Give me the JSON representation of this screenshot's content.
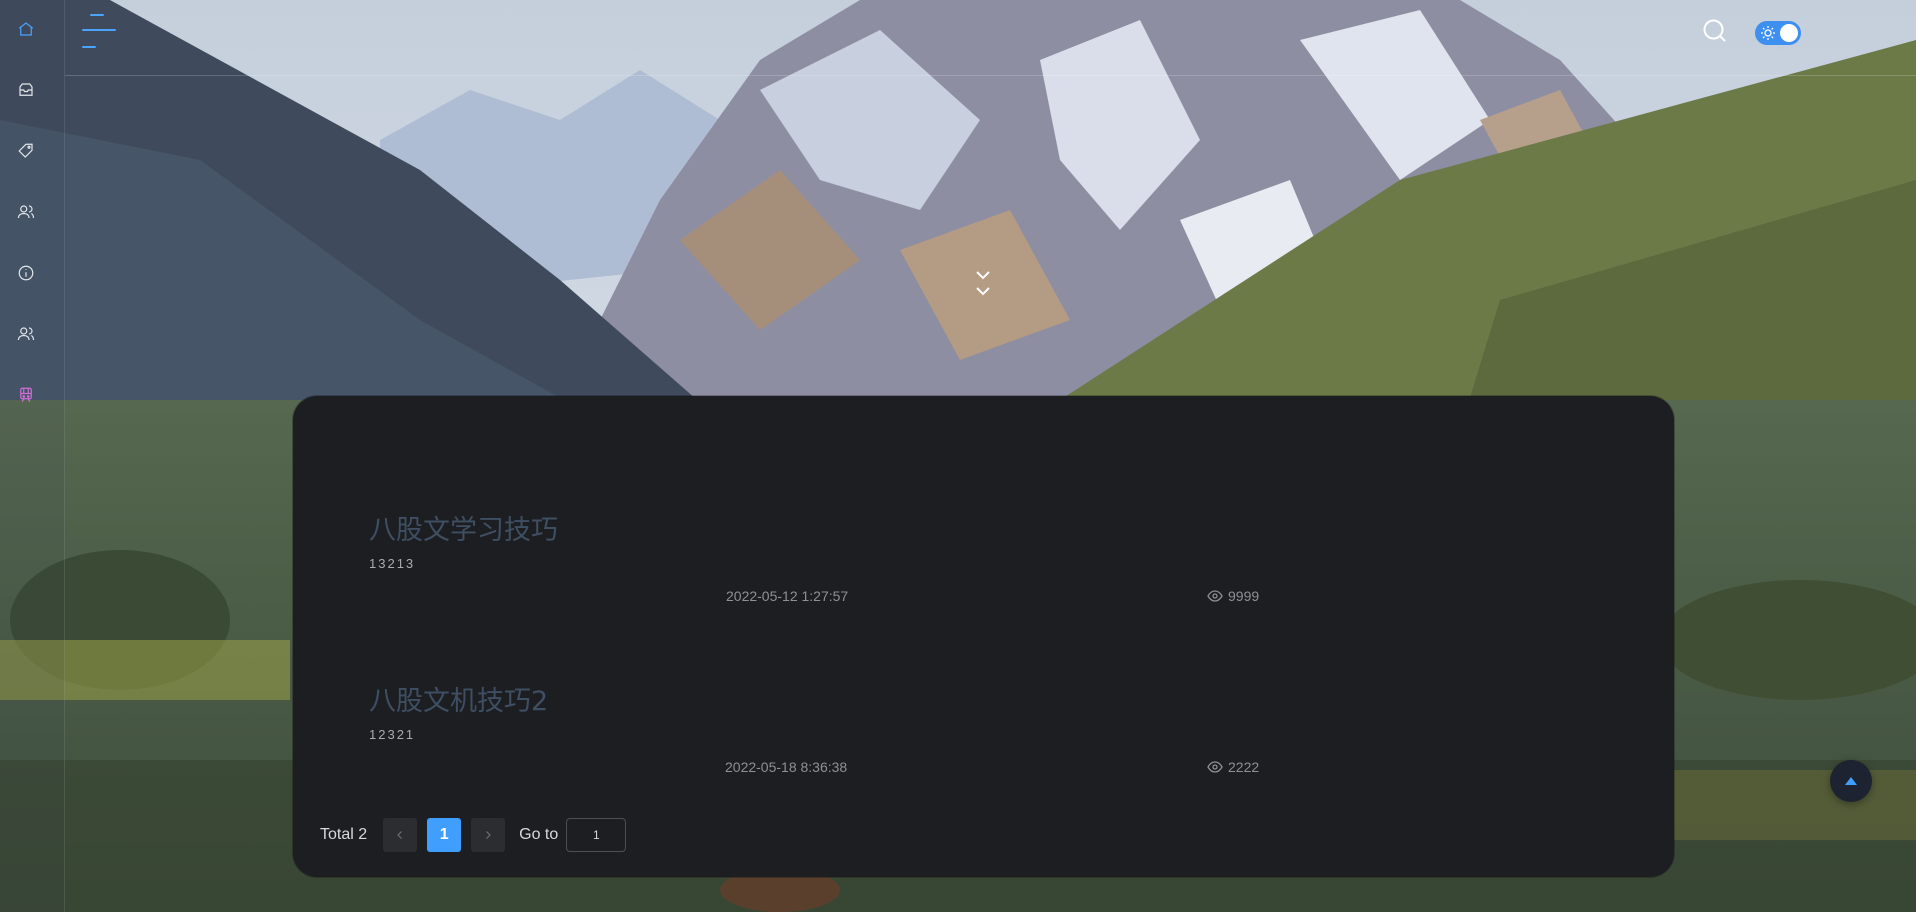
{
  "header": {
    "menu_icon": "hamburger-menu-icon",
    "search_icon": "search-icon",
    "theme_toggle": {
      "icon": "sun-icon",
      "state": "on"
    },
    "scroll_down_icon": "double-chevron-down-icon"
  },
  "sidebar": {
    "items": [
      {
        "icon": "home-icon"
      },
      {
        "icon": "inbox-icon"
      },
      {
        "icon": "tag-icon"
      },
      {
        "icon": "users-icon"
      },
      {
        "icon": "info-icon"
      },
      {
        "icon": "users-icon"
      },
      {
        "icon": "train-icon"
      }
    ]
  },
  "articles": [
    {
      "title": "八股文学习技巧",
      "summary": "13213",
      "date": "2022-05-12 1:27:57",
      "views": "9999"
    },
    {
      "title": "八股文机技巧2",
      "summary": "12321",
      "date": "2022-05-18 8:36:38",
      "views": "2222"
    }
  ],
  "pagination": {
    "total_label": "Total 2",
    "current_page": "1",
    "goto_label": "Go to",
    "goto_value": "1"
  },
  "back_to_top_icon": "caret-up-icon",
  "colors": {
    "accent": "#409eff",
    "card_bg": "#1d1e21",
    "title_color": "#3e4e63"
  }
}
